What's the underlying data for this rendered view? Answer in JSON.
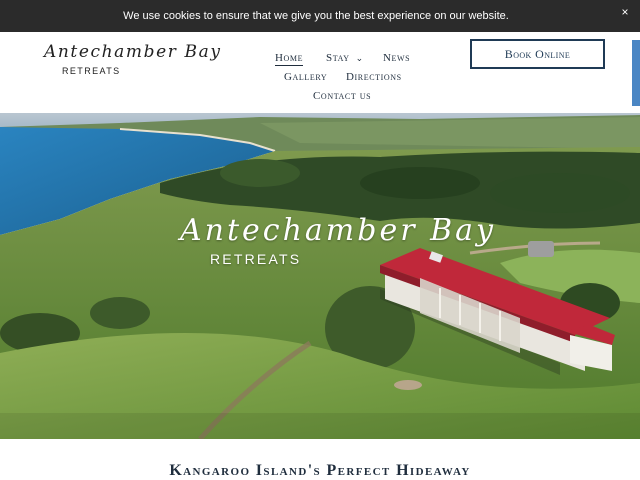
{
  "cookie_bar": {
    "message": "We use cookies to ensure that we give you the best experience on our website.",
    "close_label": "×"
  },
  "logo": {
    "script": "Antechamber Bay",
    "sub": "RETREATS"
  },
  "nav": {
    "home": "Home",
    "stay": "Stay",
    "news": "News",
    "gallery": "Gallery",
    "directions": "Directions",
    "contact": "Contact us",
    "stay_chevron": "⌄"
  },
  "book_button": "Book Online",
  "hero": {
    "title": "Antechamber Bay",
    "subtitle": "RETREATS"
  },
  "tagline": "Kangaroo Island's Perfect Hideaway",
  "colors": {
    "navy": "#1f2d3d",
    "cookie_bg": "#2b2b2b",
    "roof_red": "#c0283a",
    "sea_blue": "#1f6fa3"
  }
}
